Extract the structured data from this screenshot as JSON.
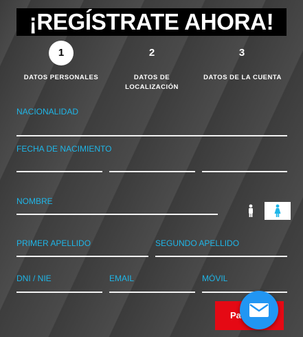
{
  "header": {
    "title": "¡REGÍSTRATE AHORA!"
  },
  "steps": [
    {
      "number": "1",
      "label": "DATOS PERSONALES",
      "active": true
    },
    {
      "number": "2",
      "label": "DATOS DE LOCALIZACIÓN",
      "active": false
    },
    {
      "number": "3",
      "label": "DATOS DE LA CUENTA",
      "active": false
    }
  ],
  "form": {
    "nationality_label": "NACIONALIDAD",
    "birthdate_label": "FECHA DE NACIMIENTO",
    "name_label": "NOMBRE",
    "first_surname_label": "PRIMER APELLIDO",
    "second_surname_label": "SEGUNDO APELLIDO",
    "dni_label": "DNI / NIE",
    "email_label": "EMAIL",
    "mobile_label": "MÓVIL"
  },
  "gender": {
    "male_icon": "male-icon",
    "female_icon": "female-icon",
    "selected": "female"
  },
  "actions": {
    "next_label": "Pa"
  },
  "colors": {
    "accent": "#1fb6e8",
    "button": "#e50914",
    "fab": "#2196f3"
  }
}
